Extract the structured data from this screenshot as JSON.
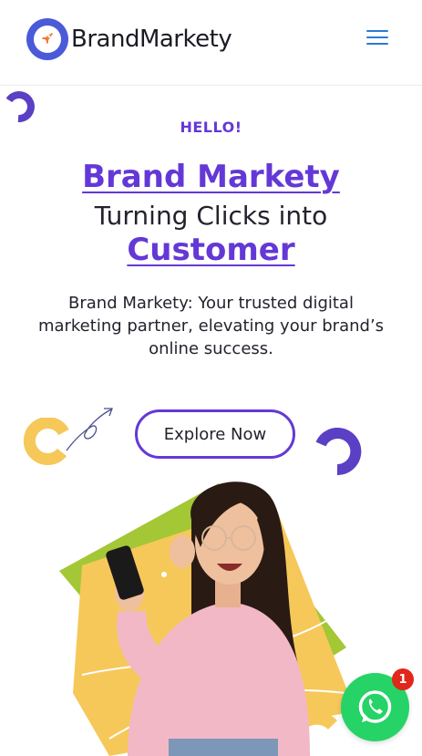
{
  "header": {
    "logo_text": "BrandMarkety",
    "logo_icon": "rocket-icon",
    "menu_icon": "hamburger-menu-icon"
  },
  "hero": {
    "eyebrow": "HELLO!",
    "title_line1": "Brand Markety",
    "title_line2": "Turning Clicks into",
    "title_line3": "Customer",
    "description_line1": "Brand Markety: Your trusted digital",
    "description_line2": "marketing partner, elevating your brand’s",
    "description_line3": "online success.",
    "cta_label": "Explore Now"
  },
  "whatsapp": {
    "icon": "whatsapp-icon",
    "badge_count": "1"
  },
  "colors": {
    "accent": "#6438d6",
    "yellow": "#f6c85a",
    "green": "#a4c735",
    "pink": "#f2b8c6",
    "whatsapp": "#25d366",
    "badge": "#e1261c"
  }
}
